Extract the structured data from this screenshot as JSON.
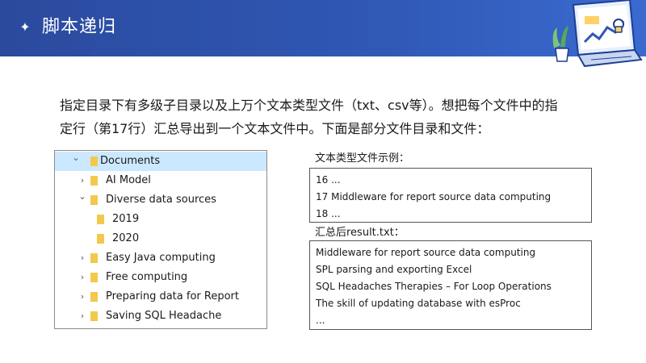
{
  "header": {
    "title": "脚本递归",
    "star_glyph": "✦"
  },
  "intro": {
    "line1": "指定目录下有多级子目录以及上万个文本类型文件（txt、csv等）。想把每个文件中的指",
    "line2": "定行（第17行）汇总导出到一个文本文件中。下面是部分文件目录和文件："
  },
  "tree": {
    "items": [
      {
        "label": "Documents",
        "expanded": true,
        "selected": true,
        "level": 0,
        "has_children": true
      },
      {
        "label": "AI Model",
        "expanded": false,
        "selected": false,
        "level": 1,
        "has_children": true
      },
      {
        "label": "Diverse data sources",
        "expanded": true,
        "selected": false,
        "level": 1,
        "has_children": true
      },
      {
        "label": "2019",
        "expanded": false,
        "selected": false,
        "level": 2,
        "has_children": false
      },
      {
        "label": "2020",
        "expanded": false,
        "selected": false,
        "level": 2,
        "has_children": false
      },
      {
        "label": "Easy Java computing",
        "expanded": false,
        "selected": false,
        "level": 1,
        "has_children": true
      },
      {
        "label": "Free computing",
        "expanded": false,
        "selected": false,
        "level": 1,
        "has_children": true
      },
      {
        "label": "Preparing data for Report",
        "expanded": false,
        "selected": false,
        "level": 1,
        "has_children": true
      },
      {
        "label": "Saving SQL Headache",
        "expanded": false,
        "selected": false,
        "level": 1,
        "has_children": true
      }
    ],
    "chevron_expanded": "⌄",
    "chevron_collapsed": "›",
    "folder_icon": "folder-icon",
    "folder_color": "#f2c94c",
    "selected_color": "#cce8ff"
  },
  "sample": {
    "label": "文本类型文件示例：",
    "lines": [
      "16 ...",
      "17 Middleware for report source data computing",
      "18 ..."
    ]
  },
  "result": {
    "label": "汇总后result.txt：",
    "lines": [
      "Middleware for report source data computing",
      "SPL parsing and exporting Excel",
      "SQL Headaches Therapies – For Loop Operations",
      "The skill of updating database with esProc",
      "..."
    ]
  }
}
